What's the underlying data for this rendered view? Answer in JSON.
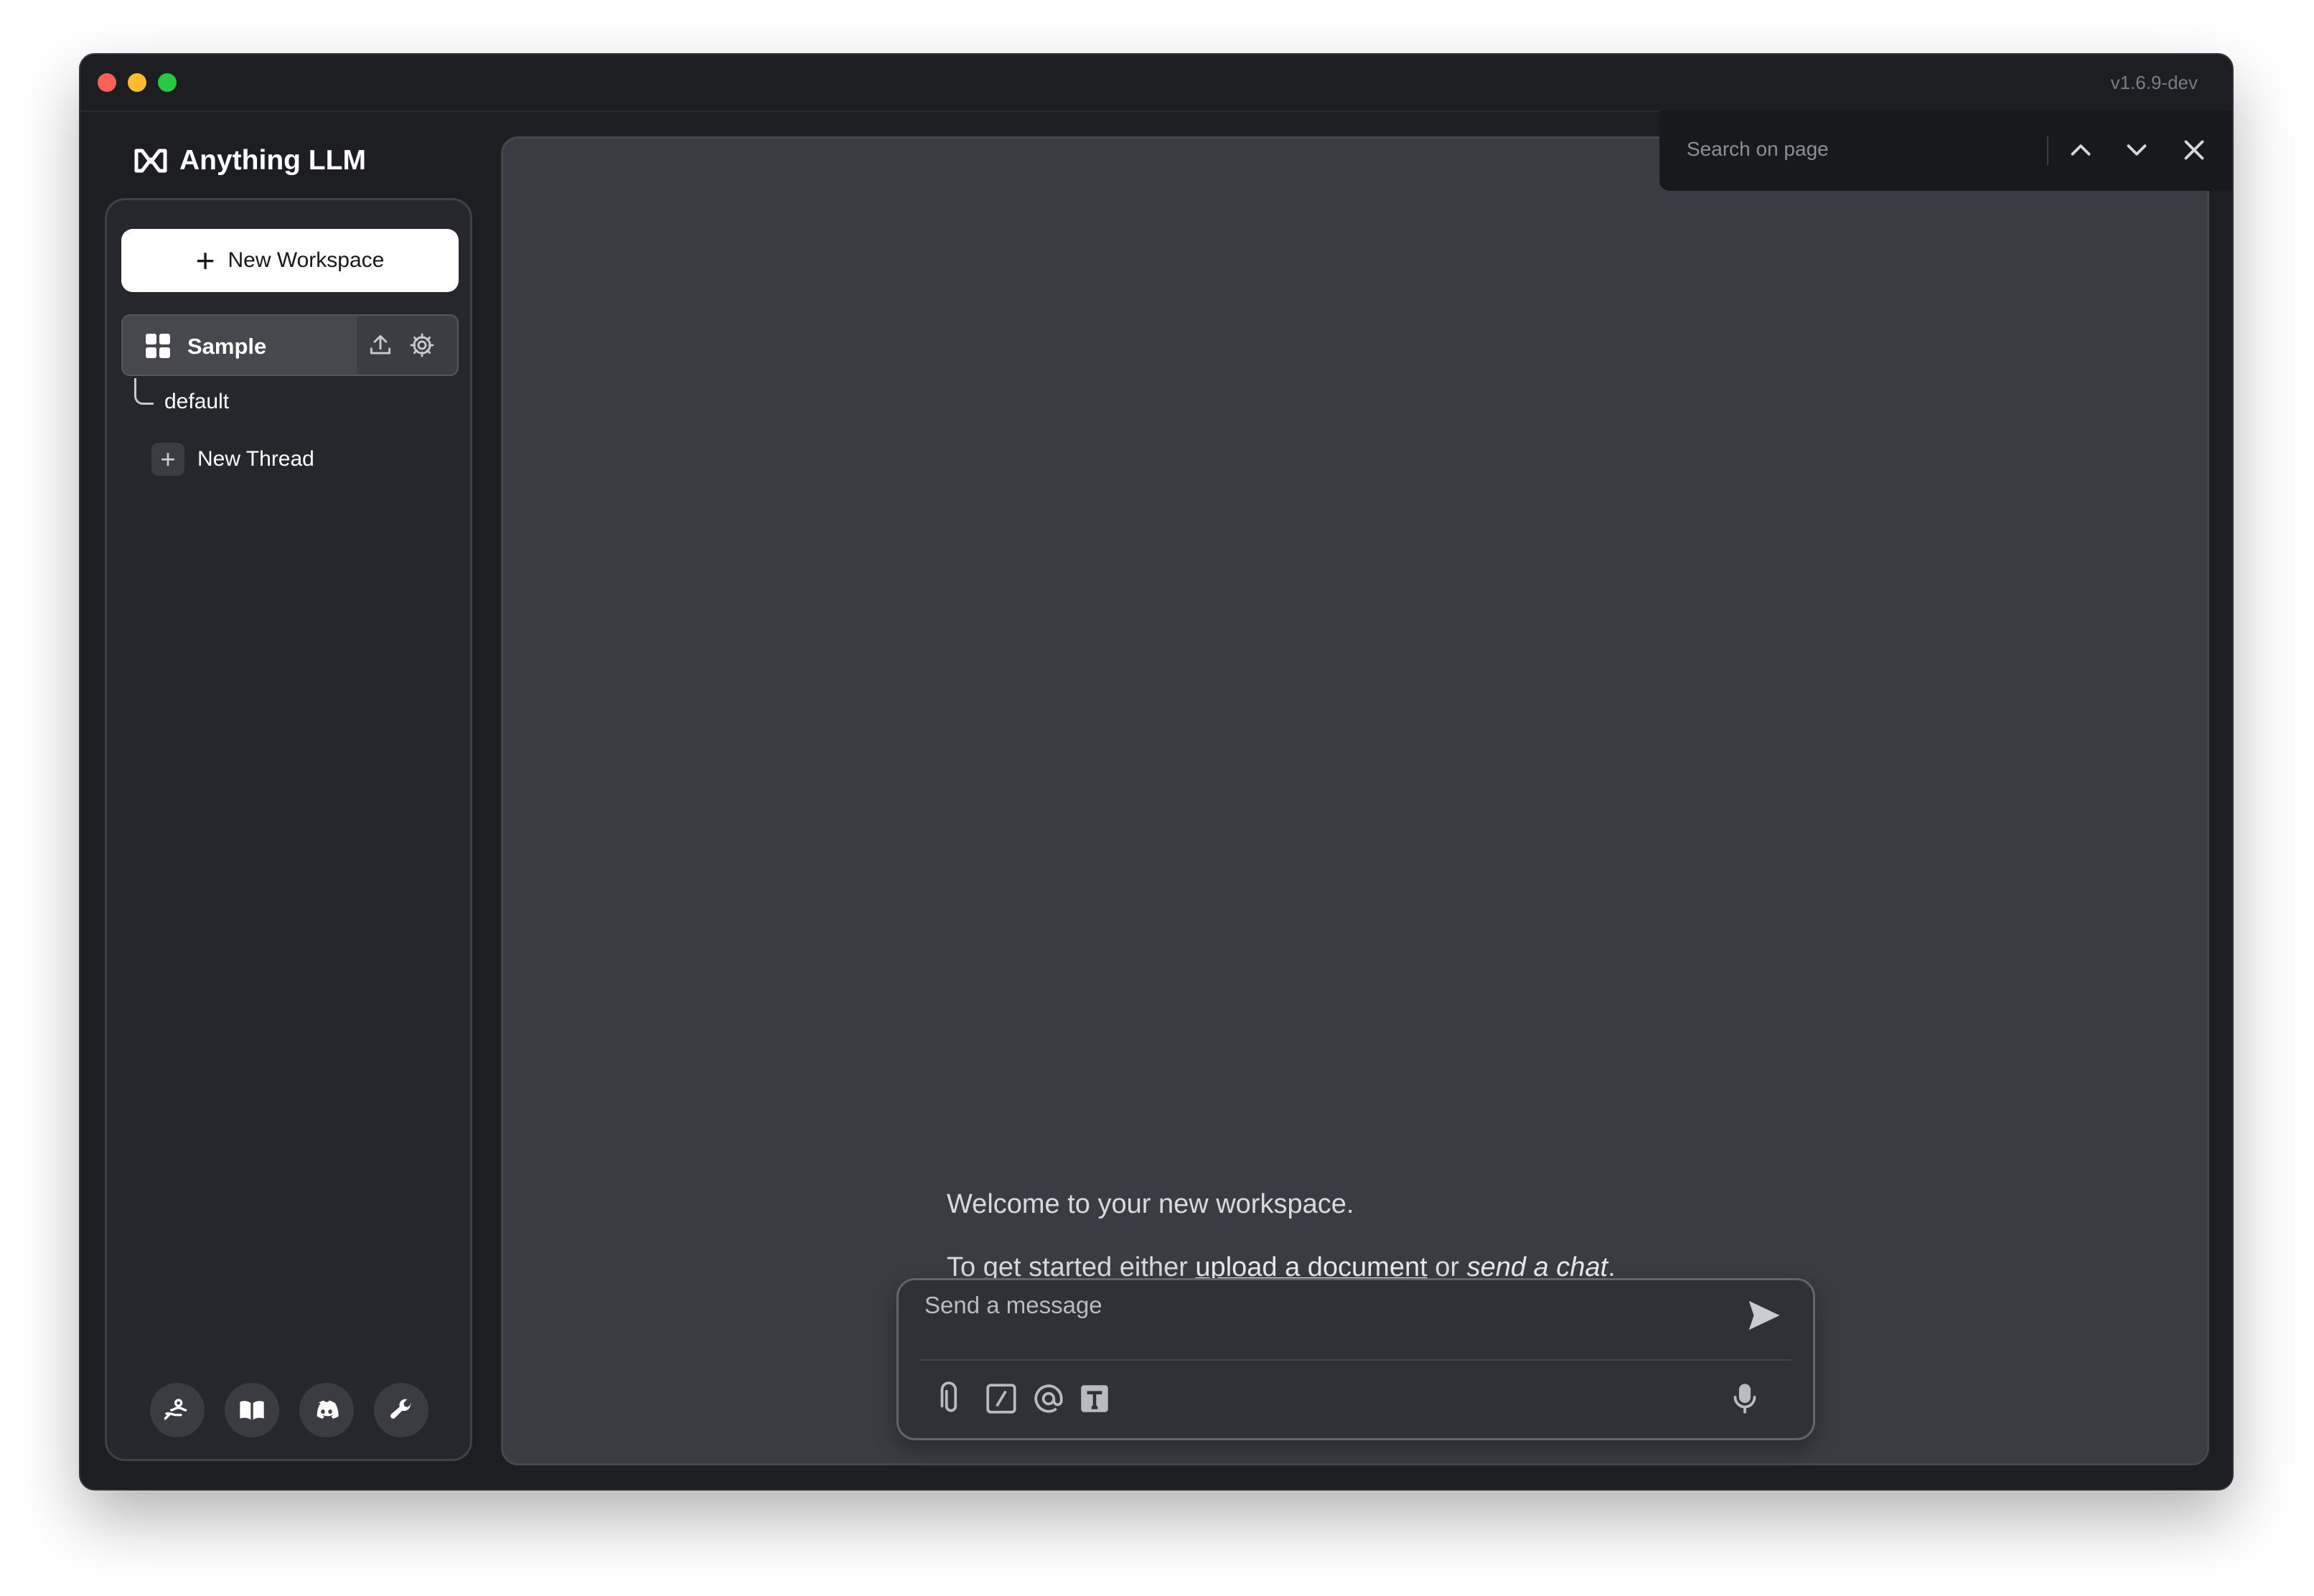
{
  "window": {
    "version": "v1.6.9-dev"
  },
  "brand": {
    "name": "Anything LLM"
  },
  "sidebar": {
    "new_workspace_label": "New Workspace",
    "workspace": {
      "name": "Sample"
    },
    "threads": [
      {
        "label": "default"
      }
    ],
    "new_thread_label": "New Thread",
    "footer_icons": [
      "community-hub-icon",
      "docs-book-icon",
      "discord-icon",
      "settings-wrench-icon"
    ]
  },
  "main": {
    "welcome_line1": "Welcome to your new workspace.",
    "welcome_line2_prefix": "To get started either ",
    "upload_link": "upload a document",
    "welcome_line2_mid": " or ",
    "send_chat": "send a chat",
    "welcome_line2_suffix": "."
  },
  "composer": {
    "placeholder": "Send a message",
    "tools": [
      "attach-icon",
      "slash-command-icon",
      "mention-icon",
      "text-format-icon"
    ]
  },
  "search_on_page": {
    "placeholder": "Search on page"
  }
}
